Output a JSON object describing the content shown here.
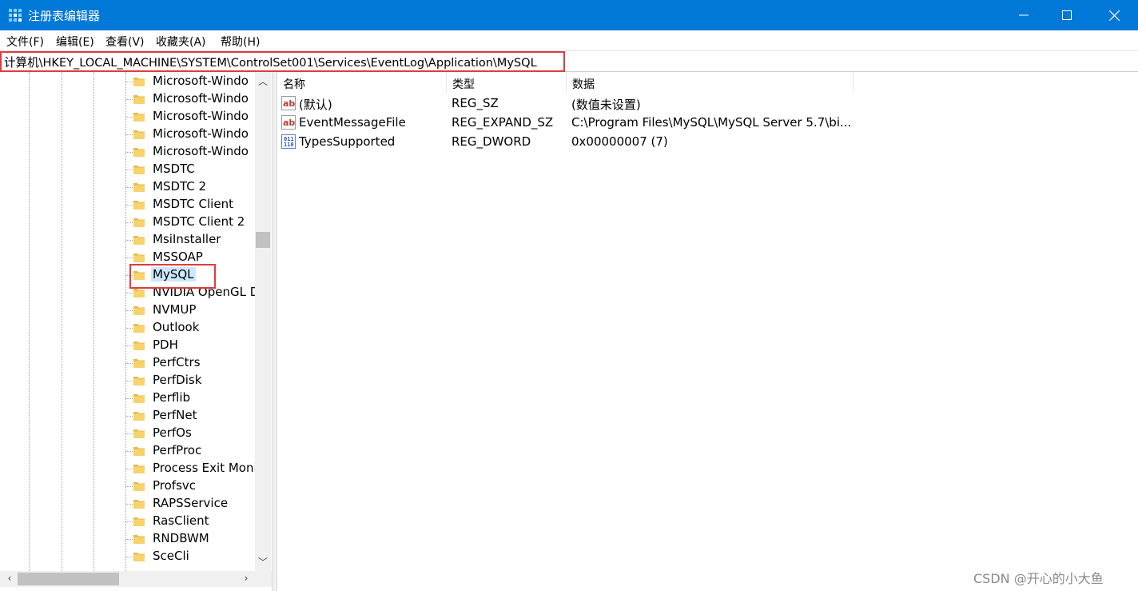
{
  "window": {
    "title": "注册表编辑器",
    "accent_color": "#0078d7"
  },
  "menu": [
    {
      "label": "文件(F)"
    },
    {
      "label": "编辑(E)"
    },
    {
      "label": "查看(V)"
    },
    {
      "label": "收藏夹(A)"
    },
    {
      "label": "帮助(H)"
    }
  ],
  "address": {
    "path": "计算机\\HKEY_LOCAL_MACHINE\\SYSTEM\\ControlSet001\\Services\\EventLog\\Application\\MySQL"
  },
  "tree": {
    "items": [
      {
        "label": "Microsoft-Windo"
      },
      {
        "label": "Microsoft-Windo"
      },
      {
        "label": "Microsoft-Windo"
      },
      {
        "label": "Microsoft-Windo"
      },
      {
        "label": "Microsoft-Windo"
      },
      {
        "label": "MSDTC"
      },
      {
        "label": "MSDTC 2"
      },
      {
        "label": "MSDTC Client"
      },
      {
        "label": "MSDTC Client 2"
      },
      {
        "label": "MsiInstaller"
      },
      {
        "label": "MSSOAP"
      },
      {
        "label": "MySQL",
        "selected": true
      },
      {
        "label": "NVIDIA OpenGL D"
      },
      {
        "label": "NVMUP"
      },
      {
        "label": "Outlook"
      },
      {
        "label": "PDH"
      },
      {
        "label": "PerfCtrs"
      },
      {
        "label": "PerfDisk"
      },
      {
        "label": "Perflib"
      },
      {
        "label": "PerfNet"
      },
      {
        "label": "PerfOs"
      },
      {
        "label": "PerfProc"
      },
      {
        "label": "Process Exit Moni"
      },
      {
        "label": "Profsvc"
      },
      {
        "label": "RAPSService"
      },
      {
        "label": "RasClient"
      },
      {
        "label": "RNDBWM"
      },
      {
        "label": "SceCli"
      }
    ]
  },
  "list": {
    "columns": [
      {
        "label": "名称"
      },
      {
        "label": "类型"
      },
      {
        "label": "数据"
      }
    ],
    "rows": [
      {
        "icon": "string-value-icon",
        "name": "(默认)",
        "type": "REG_SZ",
        "data": "(数值未设置)"
      },
      {
        "icon": "string-value-icon",
        "name": "EventMessageFile",
        "type": "REG_EXPAND_SZ",
        "data": "C:\\Program Files\\MySQL\\MySQL Server 5.7\\bi..."
      },
      {
        "icon": "binary-value-icon",
        "name": "TypesSupported",
        "type": "REG_DWORD",
        "data": "0x00000007 (7)"
      }
    ]
  },
  "watermark": "CSDN @开心的小大鱼",
  "highlight_color": "#e03c3c"
}
